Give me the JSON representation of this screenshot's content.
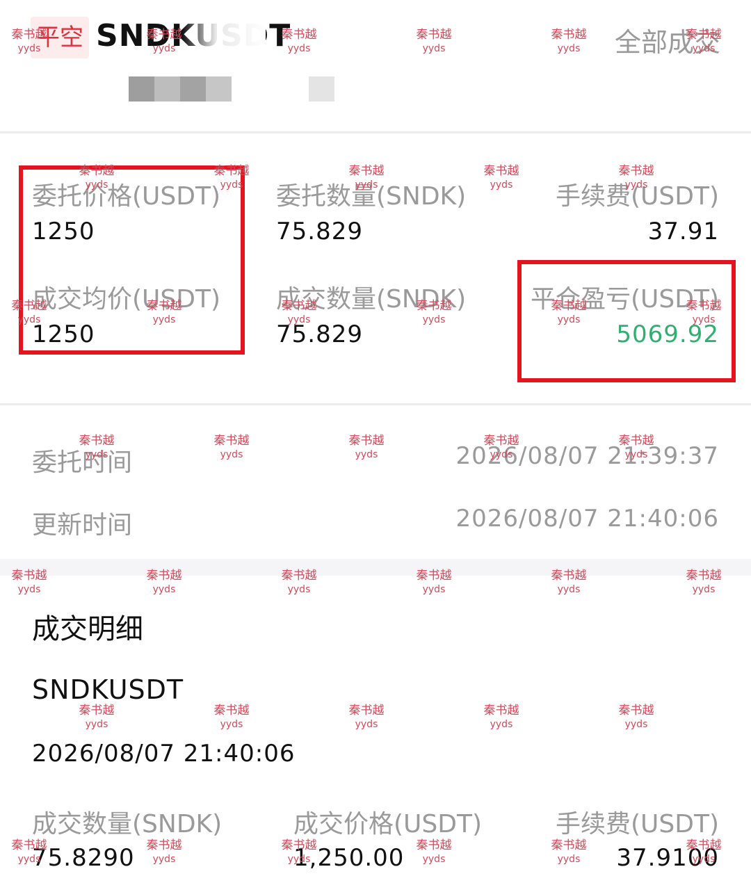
{
  "header": {
    "side_badge": "平空",
    "symbol": "SNDKUSDT",
    "status": "全部成交"
  },
  "order": {
    "order_price_label": "委托价格(USDT)",
    "order_price": "1250",
    "order_qty_label": "委托数量(SNDK)",
    "order_qty": "75.829",
    "fee_label": "手续费(USDT)",
    "fee": "37.91",
    "avg_price_label": "成交均价(USDT)",
    "avg_price": "1250",
    "filled_qty_label": "成交数量(SNDK)",
    "filled_qty": "75.829",
    "pnl_label": "平仓盈亏(USDT)",
    "pnl": "5069.92"
  },
  "times": {
    "order_time_label": "委托时间",
    "order_time": "2026/08/07 21:39:37",
    "update_time_label": "更新时间",
    "update_time": "2026/08/07 21:40:06"
  },
  "details": {
    "title": "成交明细",
    "symbol": "SNDKUSDT",
    "time": "2026/08/07 21:40:06",
    "filled_qty_label": "成交数量(SNDK)",
    "filled_qty": "75.8290",
    "price_label": "成交价格(USDT)",
    "price": "1,250.00",
    "fee_label": "手续费(USDT)",
    "fee": "37.9100"
  },
  "watermark": {
    "line1": "秦书越",
    "line2": "yyds"
  },
  "colors": {
    "profit_green": "#2fb071",
    "highlight_red": "#e5131d",
    "short_red": "#e0313b"
  }
}
